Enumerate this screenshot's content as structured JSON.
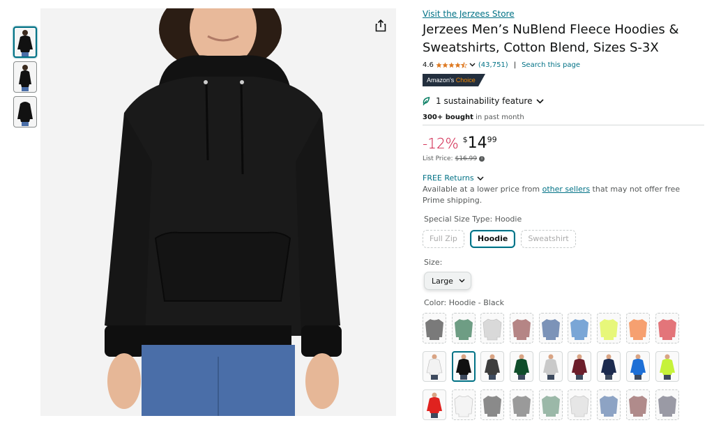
{
  "store_link": "Visit the Jerzees Store",
  "title": "Jerzees Men’s NuBlend Fleece Hoodies & Sweatshirts, Cotton Blend, Sizes S-3X",
  "rating": {
    "value": "4.6",
    "stars": 4.5,
    "count": "(43,751)",
    "separator": "|",
    "search_page": "Search this page"
  },
  "badge": {
    "prefix": "Amazon's ",
    "highlight": "Choice"
  },
  "sustainability": "1 sustainability feature",
  "bought": {
    "bold": "300+ bought",
    "rest": " in past month"
  },
  "price": {
    "discount": "-12%",
    "symbol": "$",
    "whole": "14",
    "fraction": "99",
    "list_label": "List Price:",
    "list_value": "$16.99"
  },
  "returns": "FREE Returns",
  "availability": {
    "before": "Available at a lower price from ",
    "link": "other sellers",
    "after": " that may not offer free Prime shipping."
  },
  "special_size": {
    "label": "Special Size Type: ",
    "value": "Hoodie",
    "options": [
      "Full Zip",
      "Hoodie",
      "Sweatshirt"
    ],
    "selected": 1
  },
  "size": {
    "label": "Size:",
    "value": "Large"
  },
  "color": {
    "label": "Color: ",
    "value": "Hoodie - Black",
    "swatches": [
      {
        "c": "#7a7a7a",
        "style": "sweat"
      },
      {
        "c": "#6e9d84",
        "style": "sweat"
      },
      {
        "c": "#d9d9d9",
        "style": "sweat"
      },
      {
        "c": "#b58585",
        "style": "sweat"
      },
      {
        "c": "#7c93b8",
        "style": "sweat"
      },
      {
        "c": "#7aa6d6",
        "style": "sweat"
      },
      {
        "c": "#e7f77a",
        "style": "sweat"
      },
      {
        "c": "#f6a070",
        "style": "sweat"
      },
      {
        "c": "#e3757a",
        "style": "sweat"
      },
      {
        "c": "#f2f2f2",
        "style": "hood"
      },
      {
        "c": "#111111",
        "style": "hood"
      },
      {
        "c": "#3d3d3d",
        "style": "hood"
      },
      {
        "c": "#0f4d2a",
        "style": "hood"
      },
      {
        "c": "#c9c9c9",
        "style": "hood"
      },
      {
        "c": "#6b1d2a",
        "style": "hood"
      },
      {
        "c": "#1b2a4e",
        "style": "hood"
      },
      {
        "c": "#1d6fd6",
        "style": "hood"
      },
      {
        "c": "#c6f23a",
        "style": "hood"
      },
      {
        "c": "#e0221f",
        "style": "hood"
      },
      {
        "c": "#f4f4f4",
        "style": "sweat"
      },
      {
        "c": "#8a8a8a",
        "style": "sweat"
      },
      {
        "c": "#9a9a9a",
        "style": "sweat"
      },
      {
        "c": "#9bb8a8",
        "style": "sweat"
      },
      {
        "c": "#e6e6e6",
        "style": "sweat"
      },
      {
        "c": "#8da3c4",
        "style": "sweat"
      },
      {
        "c": "#b08b8b",
        "style": "sweat"
      },
      {
        "c": "#9a9aa5",
        "style": "sweat"
      }
    ],
    "selected": 10
  }
}
